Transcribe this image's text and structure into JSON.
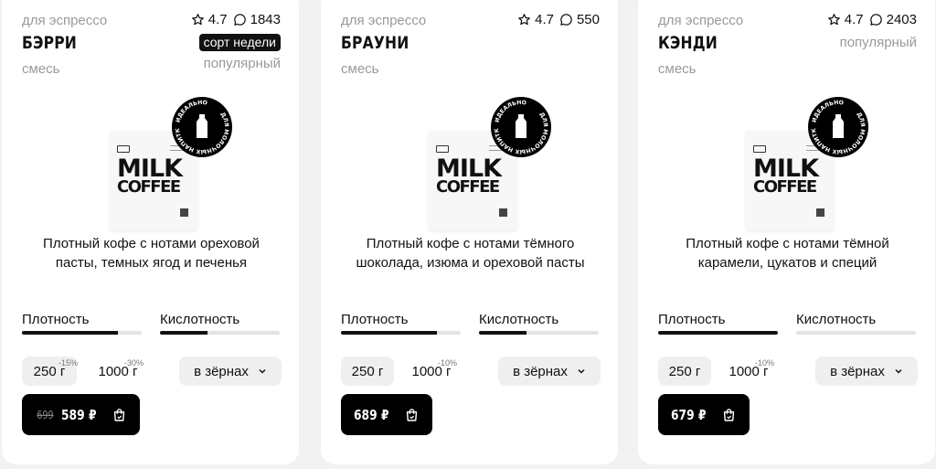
{
  "products": [
    {
      "tag": "для эспрессо",
      "rating": "4.7",
      "reviews": "1843",
      "name": "БЭРРИ",
      "badge": "сорт недели",
      "type": "смесь",
      "popular": "популярный",
      "pack_logo_line1": "MILK",
      "pack_logo_line2": "COFFEE",
      "stamp_line1": "ИДЕАЛЬНО",
      "stamp_line2": "ДЛЯ МОЛОЧНЫХ НАПИТКОВ",
      "description": "Плотный кофе с нотами ореховой пасты, темных ягод и печенья",
      "density_label": "Плотность",
      "density": 0.8,
      "acidity_label": "Кислотность",
      "acidity": 0.4,
      "weight_250": "250 г",
      "discount_250": "-15%",
      "weight_1000": "1000 г",
      "discount_1000": "-30%",
      "grind": "в зёрнах",
      "old_price": "699",
      "price": "589 ₽"
    },
    {
      "tag": "для эспрессо",
      "rating": "4.7",
      "reviews": "550",
      "name": "БРАУНИ",
      "badge": "",
      "type": "смесь",
      "popular": "",
      "pack_logo_line1": "MILK",
      "pack_logo_line2": "COFFEE",
      "stamp_line1": "ИДЕАЛЬНО",
      "stamp_line2": "ДЛЯ МОЛОЧНЫХ НАПИТКОВ",
      "description": "Плотный кофе с нотами тёмного шоколада, изюма и ореховой пасты",
      "density_label": "Плотность",
      "density": 0.8,
      "acidity_label": "Кислотность",
      "acidity": 0.4,
      "weight_250": "250 г",
      "discount_250": "",
      "weight_1000": "1000 г",
      "discount_1000": "-10%",
      "grind": "в зёрнах",
      "old_price": "",
      "price": "689 ₽"
    },
    {
      "tag": "для эспрессо",
      "rating": "4.7",
      "reviews": "2403",
      "name": "КЭНДИ",
      "badge": "популярный",
      "type": "смесь",
      "popular": "",
      "pack_logo_line1": "MILK",
      "pack_logo_line2": "COFFEE",
      "stamp_line1": "ИДЕАЛЬНО",
      "stamp_line2": "ДЛЯ МОЛОЧНЫХ НАПИТКОВ",
      "description": "Плотный кофе с нотами тёмной карамели, цукатов и специй",
      "density_label": "Плотность",
      "density": 1.0,
      "acidity_label": "Кислотность",
      "acidity": 0.0,
      "weight_250": "250 г",
      "discount_250": "",
      "weight_1000": "1000 г",
      "discount_1000": "-10%",
      "grind": "в зёрнах",
      "old_price": "",
      "price": "679 ₽"
    }
  ],
  "colors": {
    "background": "#f2f2f2",
    "card": "#ffffff",
    "accent": "#000000",
    "muted": "#9a9a9a",
    "chip": "#efefef"
  },
  "icons": {
    "rating": "star-icon",
    "reviews": "comment-icon",
    "cart": "shopping-bag-icon",
    "grind": "chevron-down-icon"
  }
}
